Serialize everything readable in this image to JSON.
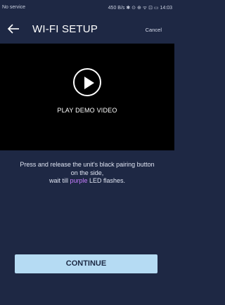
{
  "status_bar": {
    "carrier": "No service",
    "right": "450 B/s ✱ ⊙ ⊕ ᯤ ⊡ ▭ 14:03"
  },
  "header": {
    "title": "WI-FI SETUP",
    "cancel_label": "Cancel"
  },
  "video": {
    "label": "PLAY DEMO VIDEO"
  },
  "instructions": {
    "line1": "Press and release the unit's black pairing button on the side,",
    "line2_before": "wait till ",
    "highlight": "purple",
    "line2_after": " LED flashes."
  },
  "actions": {
    "continue_label": "CONTINUE"
  },
  "colors": {
    "background": "#1e2844",
    "video_background": "#000000",
    "button": "#b5dbf3",
    "highlight": "#c77dff"
  },
  "icons": {
    "back": "arrow-left-icon",
    "play": "play-icon"
  }
}
